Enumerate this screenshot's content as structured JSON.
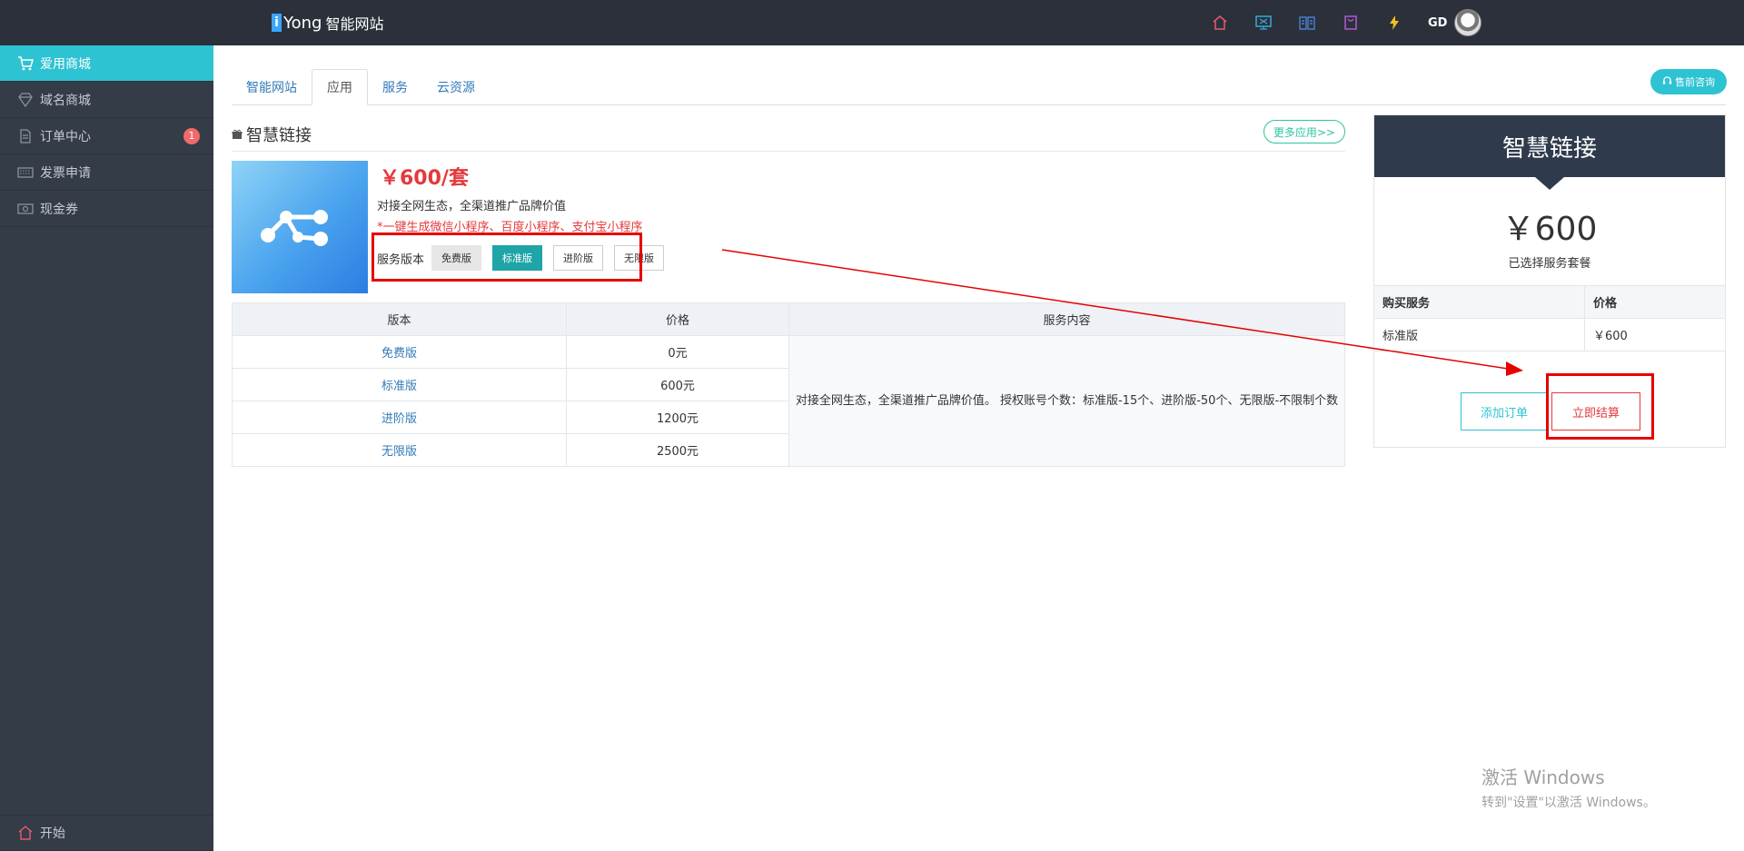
{
  "topbar": {
    "brand_mark": "i",
    "brand_name": "Yong",
    "brand_sub": "智能网站",
    "icons": [
      "home-icon",
      "monitor-icon",
      "book-icon",
      "bag-icon",
      "bolt-icon"
    ],
    "user": "GD"
  },
  "sidebar": {
    "items": [
      {
        "label": "爱用商城",
        "icon": "cart-icon"
      },
      {
        "label": "域名商城",
        "icon": "diamond-icon"
      },
      {
        "label": "订单中心",
        "icon": "document-icon",
        "badge": "1"
      },
      {
        "label": "发票申请",
        "icon": "keyboard-icon"
      },
      {
        "label": "现金券",
        "icon": "cash-icon"
      }
    ],
    "bottom_label": "开始"
  },
  "tabs": [
    "智能网站",
    "应用",
    "服务",
    "云资源"
  ],
  "presale": "售前咨询",
  "section": {
    "title": "智慧链接",
    "more": "更多应用>>"
  },
  "product": {
    "price": "￥600/套",
    "desc": "对接全网生态，全渠道推广品牌价值",
    "note": "*一键生成微信小程序、百度小程序、支付宝小程序",
    "version_label": "服务版本",
    "versions": [
      "免费版",
      "标准版",
      "进阶版",
      "无限版"
    ]
  },
  "table": {
    "headers": [
      "版本",
      "价格",
      "服务内容"
    ],
    "rows": [
      {
        "version": "免费版",
        "price": "0元"
      },
      {
        "version": "标准版",
        "price": "600元"
      },
      {
        "version": "进阶版",
        "price": "1200元"
      },
      {
        "version": "无限版",
        "price": "2500元"
      }
    ],
    "content": "对接全网生态，全渠道推广品牌价值。 授权账号个数：标准版-15个、进阶版-50个、无限版-不限制个数"
  },
  "right_panel": {
    "title": "智慧链接",
    "price": "￥600",
    "sub": "已选择服务套餐",
    "headers": [
      "购买服务",
      "价格"
    ],
    "row": {
      "service": "标准版",
      "price": "￥600"
    },
    "add_btn": "添加订单",
    "pay_btn": "立即结算"
  },
  "watermark": {
    "line1": "激活 Windows",
    "line2": "转到\"设置\"以激活 Windows。"
  },
  "colors": {
    "accent": "#2ec3d3",
    "price_red": "#e4393c",
    "annotation_red": "#e60000",
    "selected_version": "#1fa4a8"
  }
}
